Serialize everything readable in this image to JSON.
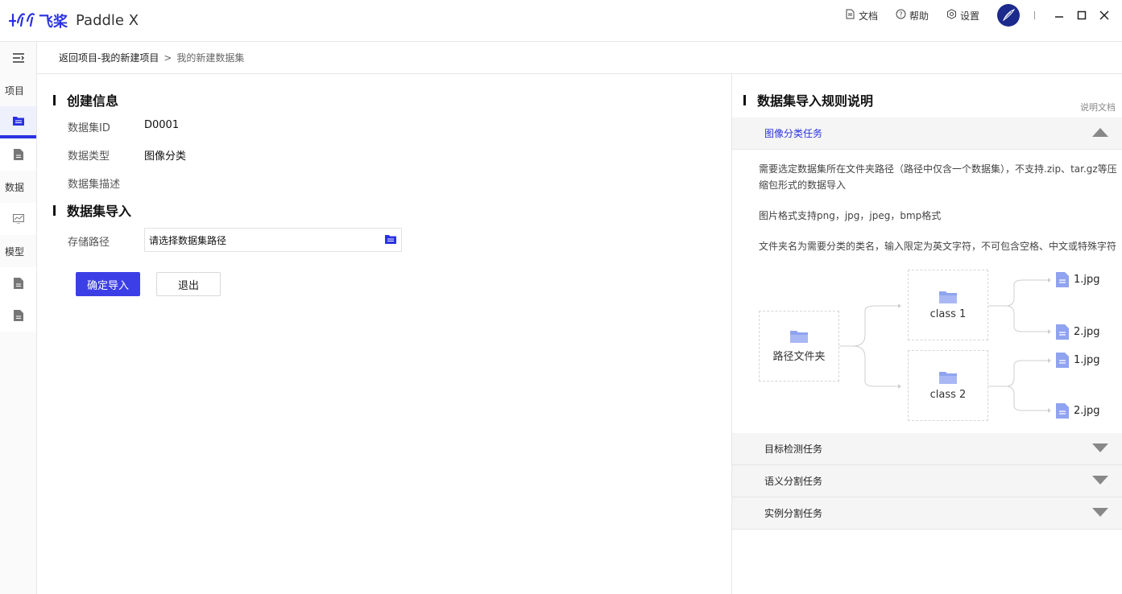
{
  "app": {
    "logo_cn": "飞桨",
    "logo_en": "Paddle X",
    "header_links": [
      {
        "label": "文档",
        "icon": "document-icon"
      },
      {
        "label": "帮助",
        "icon": "help-icon"
      },
      {
        "label": "设置",
        "icon": "settings-icon"
      }
    ]
  },
  "sidebar": {
    "sections": [
      "项目",
      "数据",
      "模型"
    ]
  },
  "breadcrumb": {
    "back": "返回项目-我的新建项目",
    "separator": ">",
    "current": "我的新建数据集"
  },
  "create_info": {
    "title": "创建信息",
    "id_label": "数据集ID",
    "id_value": "D0001",
    "type_label": "数据类型",
    "type_value": "图像分类",
    "desc_label": "数据集描述"
  },
  "import": {
    "title": "数据集导入",
    "path_label": "存储路径",
    "path_value": "请选择数据集路径",
    "confirm_label": "确定导入",
    "exit_label": "退出"
  },
  "rules": {
    "title": "数据集导入规则说明",
    "doc_link": "说明文档",
    "sections": [
      {
        "label": "图像分类任务",
        "expanded": true
      },
      {
        "label": "目标检测任务",
        "expanded": false
      },
      {
        "label": "语义分割任务",
        "expanded": false
      },
      {
        "label": "实例分割任务",
        "expanded": false
      }
    ],
    "desc1": "需要选定数据集所在文件夹路径（路径中仅含一个数据集），不支持.zip、tar.gz等压缩包形式的数据导入",
    "desc2": "图片格式支持png，jpg，jpeg，bmp格式",
    "desc3": "文件夹名为需要分类的类名，输入限定为英文字符，不可包含空格、中文或特殊字符",
    "diagram": {
      "root": "路径文件夹",
      "class1": "class 1",
      "class2": "class 2",
      "files": [
        "1.jpg",
        "2.jpg",
        "1.jpg",
        "2.jpg"
      ]
    }
  },
  "colors": {
    "brand": "#2932e1",
    "primary_button": "#3d3fe6",
    "folder_icon": "#8fa3ef"
  }
}
